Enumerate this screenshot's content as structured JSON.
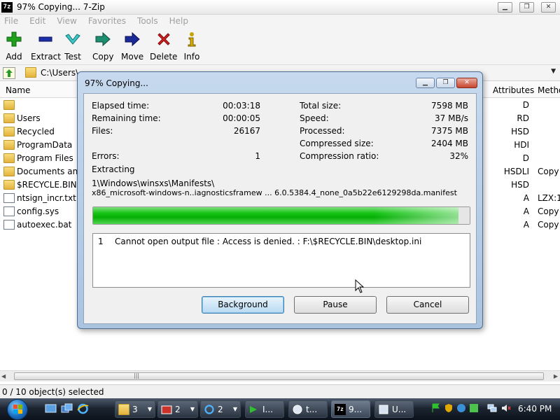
{
  "window": {
    "title": "97% Copying... 7-Zip",
    "app_icon_text": "7z",
    "controls": [
      "minimize",
      "maximize",
      "close"
    ]
  },
  "menu": [
    "File",
    "Edit",
    "View",
    "Favorites",
    "Tools",
    "Help"
  ],
  "toolbar": {
    "add": "Add",
    "extract": "Extract",
    "test": "Test",
    "copy": "Copy",
    "move": "Move",
    "delete": "Delete",
    "info": "Info"
  },
  "address": {
    "path": "C:\\Users\\"
  },
  "columns": {
    "name": "Name",
    "attributes": "Attributes",
    "method": "Metho"
  },
  "files": [
    {
      "name": "",
      "type": "folder",
      "attributes": "D",
      "method": ""
    },
    {
      "name": "Users",
      "type": "folder",
      "attributes": "RD",
      "method": ""
    },
    {
      "name": "Recycled",
      "type": "folder",
      "attributes": "HSD",
      "method": ""
    },
    {
      "name": "ProgramData",
      "type": "folder",
      "attributes": "HDI",
      "method": ""
    },
    {
      "name": "Program Files",
      "type": "folder",
      "attributes": "D",
      "method": ""
    },
    {
      "name": "Documents and",
      "type": "folder",
      "attributes": "HSDLI",
      "method": "Copy"
    },
    {
      "name": "$RECYCLE.BIN",
      "type": "folder",
      "attributes": "HSD",
      "method": ""
    },
    {
      "name": "ntsign_incr.txt",
      "type": "file",
      "attributes": "A",
      "method": "LZX:1"
    },
    {
      "name": "config.sys",
      "type": "file",
      "attributes": "A",
      "method": "Copy"
    },
    {
      "name": "autoexec.bat",
      "type": "file",
      "attributes": "A",
      "method": "Copy"
    }
  ],
  "status": {
    "text": "0 / 10 object(s) selected"
  },
  "dialog": {
    "title": "97% Copying...",
    "elapsed_label": "Elapsed time:",
    "elapsed": "00:03:18",
    "remaining_label": "Remaining time:",
    "remaining": "00:00:05",
    "files_label": "Files:",
    "files": "26167",
    "errors_label": "Errors:",
    "errors": "1",
    "total_size_label": "Total size:",
    "total_size": "7598 MB",
    "speed_label": "Speed:",
    "speed": "37 MB/s",
    "processed_label": "Processed:",
    "processed": "7375 MB",
    "compressed_size_label": "Compressed size:",
    "compressed_size": "2404 MB",
    "compression_ratio_label": "Compression ratio:",
    "compression_ratio": "32%",
    "operation": "Extracting",
    "current_path": "1\\Windows\\winsxs\\Manifests\\",
    "current_file": "x86_microsoft-windows-n..iagnosticsframew ... 6.0.5384.4_none_0a5b22e6129298da.manifest",
    "progress_percent": 97,
    "error_number": "1",
    "error_message": "Cannot open output file : Access is denied. : F:\\$RECYCLE.BIN\\desktop.ini",
    "background_button": "Background",
    "pause_button": "Pause",
    "cancel_button": "Cancel"
  },
  "taskbar": {
    "buttons": [
      {
        "label": "3",
        "icon": "folder-icon"
      },
      {
        "label": "2",
        "icon": "app-icon"
      },
      {
        "label": "2",
        "icon": "ie-icon"
      },
      {
        "label": "I...",
        "icon": "terminal-icon"
      },
      {
        "label": "t...",
        "icon": "app-icon"
      },
      {
        "label": "9...",
        "icon": "7zip-icon"
      },
      {
        "label": "U...",
        "icon": "window-icon"
      }
    ],
    "clock": "6:40 PM"
  },
  "colors": {
    "progress_green": "#16c416",
    "dialog_frame": "#aac3df",
    "taskbar": "#1d2531"
  }
}
